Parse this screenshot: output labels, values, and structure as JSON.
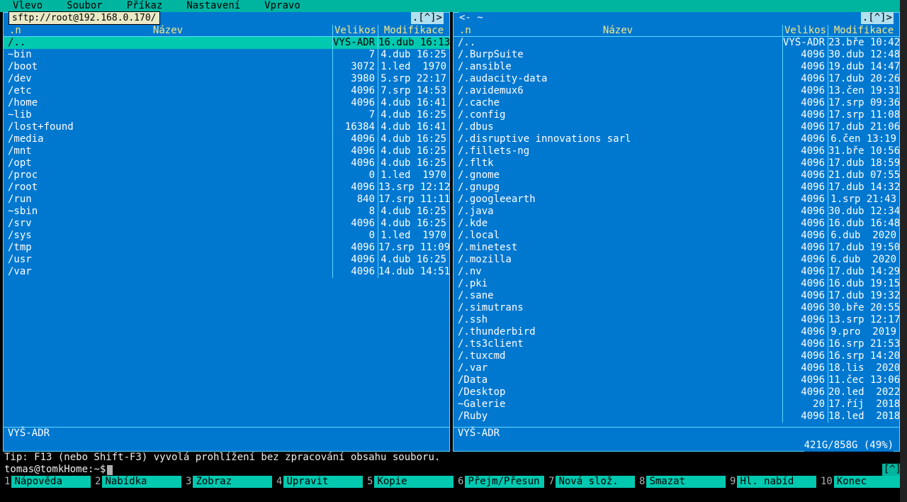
{
  "menubar": [
    "Vlevo",
    "Soubor",
    "Příkaz",
    "Nastavení",
    "Vpravo"
  ],
  "url_tip": "sftp://root@192.168.0.170/",
  "left_panel": {
    "path_prefix": "<-",
    "path_suffix": ".[^]>",
    "sort_col": ".n",
    "header": {
      "name": "Název",
      "size": "Velikos",
      "time": "Modifikace"
    },
    "footer": "VYŠ-ADR",
    "rows": [
      {
        "name": "/..",
        "size": "VYŠ-ADR",
        "time": "16.dub 16:13",
        "sel": true
      },
      {
        "name": "~bin",
        "size": "7",
        "time": "4.dub 16:25"
      },
      {
        "name": "/boot",
        "size": "3072",
        "time": "1.led  1970"
      },
      {
        "name": "/dev",
        "size": "3980",
        "time": "5.srp 22:17"
      },
      {
        "name": "/etc",
        "size": "4096",
        "time": "7.srp 14:53"
      },
      {
        "name": "/home",
        "size": "4096",
        "time": "4.dub 16:41"
      },
      {
        "name": "~lib",
        "size": "7",
        "time": "4.dub 16:25"
      },
      {
        "name": "/lost+found",
        "size": "16384",
        "time": "4.dub 16:41"
      },
      {
        "name": "/media",
        "size": "4096",
        "time": "4.dub 16:25"
      },
      {
        "name": "/mnt",
        "size": "4096",
        "time": "4.dub 16:25"
      },
      {
        "name": "/opt",
        "size": "4096",
        "time": "4.dub 16:25"
      },
      {
        "name": "/proc",
        "size": "0",
        "time": "1.led  1970"
      },
      {
        "name": "/root",
        "size": "4096",
        "time": "13.srp 12:12"
      },
      {
        "name": "/run",
        "size": "840",
        "time": "17.srp 11:11"
      },
      {
        "name": "~sbin",
        "size": "8",
        "time": "4.dub 16:25"
      },
      {
        "name": "/srv",
        "size": "4096",
        "time": "4.dub 16:25"
      },
      {
        "name": "/sys",
        "size": "0",
        "time": "1.led  1970"
      },
      {
        "name": "/tmp",
        "size": "4096",
        "time": "17.srp 11:09"
      },
      {
        "name": "/usr",
        "size": "4096",
        "time": "4.dub 16:25"
      },
      {
        "name": "/var",
        "size": "4096",
        "time": "14.dub 14:51"
      }
    ]
  },
  "right_panel": {
    "path_prefix": "<- ~",
    "path_suffix": ".[^]>",
    "sort_col": ".n",
    "header": {
      "name": "Název",
      "size": "Velikos",
      "time": "Modifikace"
    },
    "footer": "VYŠ-ADR",
    "disk_usage": "421G/858G (49%)",
    "rows": [
      {
        "name": "/..",
        "size": "VYŠ-ADR",
        "time": "23.bře 10:42"
      },
      {
        "name": "/.BurpSuite",
        "size": "4096",
        "time": "30.dub 12:48"
      },
      {
        "name": "/.ansible",
        "size": "4096",
        "time": "19.dub 14:47"
      },
      {
        "name": "/.audacity-data",
        "size": "4096",
        "time": "17.dub 20:26"
      },
      {
        "name": "/.avidemux6",
        "size": "4096",
        "time": "13.čen 19:31"
      },
      {
        "name": "/.cache",
        "size": "4096",
        "time": "17.srp 09:36"
      },
      {
        "name": "/.config",
        "size": "4096",
        "time": "17.srp 11:08"
      },
      {
        "name": "/.dbus",
        "size": "4096",
        "time": "17.dub 21:06"
      },
      {
        "name": "/.disruptive innovations sarl",
        "size": "4096",
        "time": "6.čen 13:19"
      },
      {
        "name": "/.fillets-ng",
        "size": "4096",
        "time": "31.bře 10:56"
      },
      {
        "name": "/.fltk",
        "size": "4096",
        "time": "17.dub 18:59"
      },
      {
        "name": "/.gnome",
        "size": "4096",
        "time": "21.dub 07:55"
      },
      {
        "name": "/.gnupg",
        "size": "4096",
        "time": "17.dub 14:32"
      },
      {
        "name": "/.googleearth",
        "size": "4096",
        "time": "1.srp 21:43"
      },
      {
        "name": "/.java",
        "size": "4096",
        "time": "30.dub 12:34"
      },
      {
        "name": "/.kde",
        "size": "4096",
        "time": "16.dub 16:48"
      },
      {
        "name": "/.local",
        "size": "4096",
        "time": "6.dub  2020"
      },
      {
        "name": "/.minetest",
        "size": "4096",
        "time": "17.dub 19:50"
      },
      {
        "name": "/.mozilla",
        "size": "4096",
        "time": "6.dub  2020"
      },
      {
        "name": "/.nv",
        "size": "4096",
        "time": "17.dub 14:29"
      },
      {
        "name": "/.pki",
        "size": "4096",
        "time": "16.dub 19:15"
      },
      {
        "name": "/.sane",
        "size": "4096",
        "time": "17.dub 19:32"
      },
      {
        "name": "/.simutrans",
        "size": "4096",
        "time": "30.bře 20:55"
      },
      {
        "name": "/.ssh",
        "size": "4096",
        "time": "13.srp 12:17"
      },
      {
        "name": "/.thunderbird",
        "size": "4096",
        "time": "9.pro  2019"
      },
      {
        "name": "/.ts3client",
        "size": "4096",
        "time": "16.srp 21:53"
      },
      {
        "name": "/.tuxcmd",
        "size": "4096",
        "time": "16.srp 14:20"
      },
      {
        "name": "/.var",
        "size": "4096",
        "time": "18.lis  2020"
      },
      {
        "name": "/Data",
        "size": "4096",
        "time": "11.čec 13:06"
      },
      {
        "name": "/Desktop",
        "size": "4096",
        "time": "20.led  2022"
      },
      {
        "name": "~Galerie",
        "size": "20",
        "time": "17.říj  2018"
      },
      {
        "name": "/Ruby",
        "size": "4096",
        "time": "18.led  2018"
      }
    ]
  },
  "tip": "Tip: F13 (nebo Shift-F3) vyvolá prohlížení bez zpracování obsahu souboru.",
  "prompt": "tomas@tomkHome:~$",
  "prompt_corner": "[^]",
  "fkeys": [
    {
      "n": "1",
      "l": "Nápověda"
    },
    {
      "n": "2",
      "l": "Nabídka"
    },
    {
      "n": "3",
      "l": "Zobraz"
    },
    {
      "n": "4",
      "l": "Upravit"
    },
    {
      "n": "5",
      "l": "Kopie"
    },
    {
      "n": "6",
      "l": "Přejm/Přesun"
    },
    {
      "n": "7",
      "l": "Nová slož."
    },
    {
      "n": "8",
      "l": "Smazat"
    },
    {
      "n": "9",
      "l": "Hl. nabíd"
    },
    {
      "n": "10",
      "l": "Konec"
    }
  ]
}
